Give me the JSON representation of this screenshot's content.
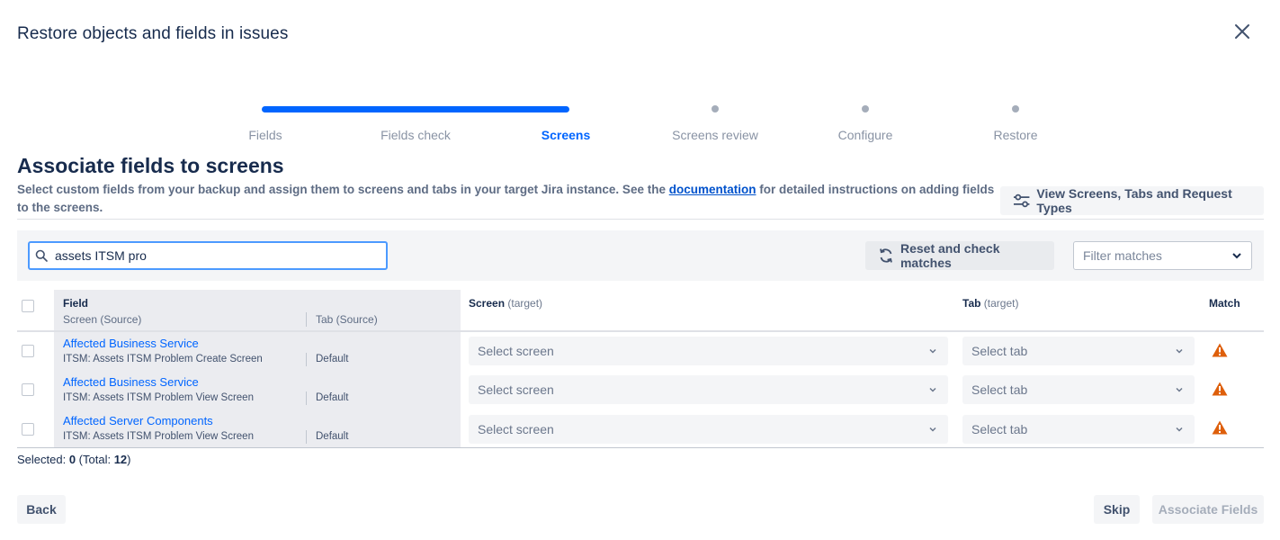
{
  "modal": {
    "title": "Restore objects and fields in issues"
  },
  "colors": {
    "accent": "#0065ff",
    "warning": "#de5f0b",
    "disabled_text": "#a5adba"
  },
  "progress": {
    "current_step": 3,
    "steps": [
      {
        "label": "Fields",
        "state": "done"
      },
      {
        "label": "Fields check",
        "state": "done"
      },
      {
        "label": "Screens",
        "state": "active"
      },
      {
        "label": "Screens review",
        "state": "todo"
      },
      {
        "label": "Configure",
        "state": "todo"
      },
      {
        "label": "Restore",
        "state": "todo"
      }
    ]
  },
  "section": {
    "title": "Associate fields to screens",
    "description_before": "Select custom fields from your backup and assign them to screens and tabs in your target Jira instance. See the ",
    "description_link": "documentation",
    "description_after": " for detailed instructions on adding fields to the screens.",
    "view_button": "View Screens, Tabs and Request Types"
  },
  "toolbar": {
    "search_value": "assets ITSM pro",
    "reset_button": "Reset and check matches",
    "filter_placeholder": "Filter matches"
  },
  "table": {
    "headers": {
      "field": "Field",
      "screen_source": "Screen (Source)",
      "tab_source": "Tab (Source)",
      "screen_target": "Screen",
      "screen_target_suffix": "(target)",
      "tab_target": "Tab",
      "tab_target_suffix": "(target)",
      "match": "Match"
    },
    "rows": [
      {
        "field": "Affected Business Service",
        "screen": "ITSM: Assets ITSM Problem Create Screen",
        "tab": "Default",
        "screen_select": "Select screen",
        "tab_select": "Select tab",
        "match_icon": "warning-icon"
      },
      {
        "field": "Affected Business Service",
        "screen": "ITSM: Assets ITSM Problem View Screen",
        "tab": "Default",
        "screen_select": "Select screen",
        "tab_select": "Select tab",
        "match_icon": "warning-icon"
      },
      {
        "field": "Affected Server Components",
        "screen": "ITSM: Assets ITSM Problem View Screen",
        "tab": "Default",
        "screen_select": "Select screen",
        "tab_select": "Select tab",
        "match_icon": "warning-icon"
      }
    ]
  },
  "selection": {
    "label": "Selected: ",
    "selected": "0",
    "total_label": " (Total: ",
    "total": "12",
    "close_paren": ")"
  },
  "footer": {
    "back": "Back",
    "skip": "Skip",
    "associate": "Associate Fields"
  }
}
